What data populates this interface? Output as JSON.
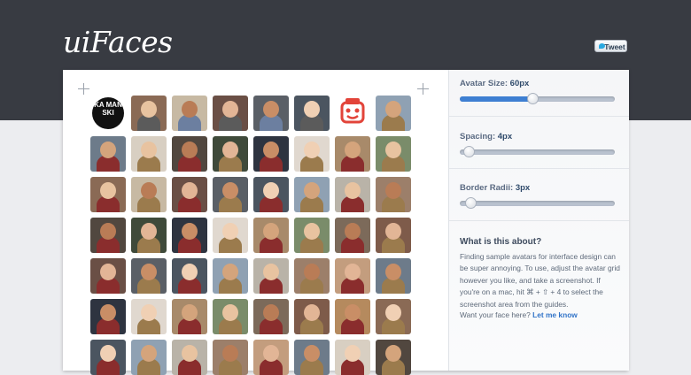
{
  "header": {
    "logo": "uiFaces",
    "tweet_label": "Tweet"
  },
  "sliders": [
    {
      "label": "Avatar Size:",
      "value": "60px",
      "fill": 0.48
    },
    {
      "label": "Spacing:",
      "value": "4px",
      "fill": 0.04
    },
    {
      "label": "Border Radii:",
      "value": "3px",
      "fill": 0.06
    }
  ],
  "about": {
    "title": "What is this about?",
    "body": "Finding sample avatars for interface design can be super annoying. To use, adjust the avatar grid however you like, and take a screenshot. If you're on a mac, hit ⌘ + ⇧ + 4 to select the screenshot area from the guides.",
    "want": "Want your face here?",
    "link": "Let me know"
  },
  "logo_avatar_text": "KA MAN SKI",
  "colors": {
    "accent": "#3e7fd2",
    "topbar": "#383b42",
    "link": "#3274c8"
  }
}
